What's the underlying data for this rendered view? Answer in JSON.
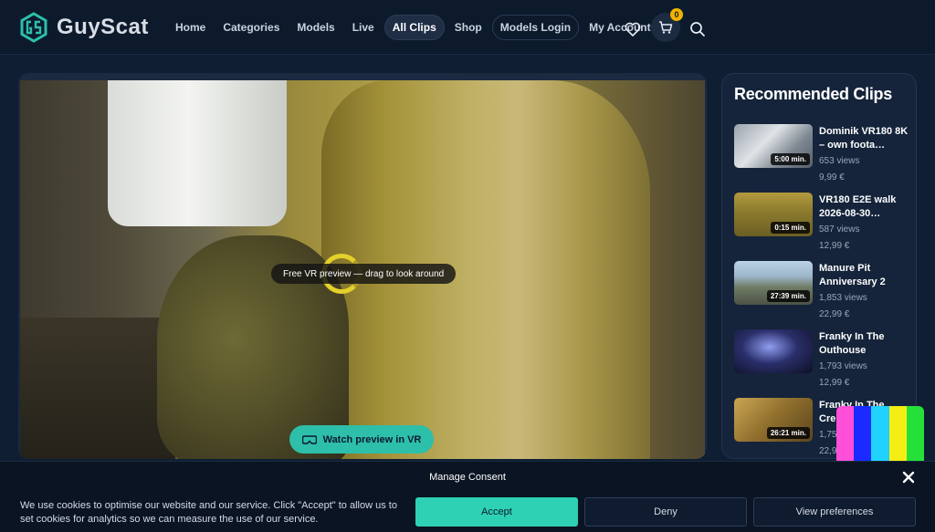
{
  "brand": {
    "name": "GuyScat",
    "logo_icon": "gs-hex-logo-icon",
    "accent": "#2dbfa9"
  },
  "nav": {
    "items": [
      {
        "label": "Home"
      },
      {
        "label": "Categories"
      },
      {
        "label": "Models"
      },
      {
        "label": "Live"
      },
      {
        "label": "All Clips",
        "active": true
      },
      {
        "label": "Shop"
      },
      {
        "label": "Models Login",
        "outlined": true
      },
      {
        "label": "My Account"
      }
    ],
    "icons": {
      "wishlist": "heart-icon",
      "cart": "cart-icon",
      "search": "search-icon"
    },
    "cart_count": "0"
  },
  "player": {
    "hint": "Free VR preview — drag to look around",
    "vr_button": "Watch preview in VR",
    "vr_icon": "vr-headset-icon"
  },
  "sidebar": {
    "title": "Recommended Clips",
    "clips": [
      {
        "title": "Dominik VR180 8K – own foota…",
        "duration": "5:00 min.",
        "views": "653 views",
        "price": "9,99 €"
      },
      {
        "title": "VR180 E2E walk 2026-08-30…",
        "duration": "0:15 min.",
        "views": "587 views",
        "price": "12,99 €"
      },
      {
        "title": "Manure Pit Anniversary 2",
        "duration": "27:39 min.",
        "views": "1,853 views",
        "price": "22,99 €"
      },
      {
        "title": "Franky In The Outhouse",
        "duration": "",
        "views": "1,793 views",
        "price": "12,99 €"
      },
      {
        "title": "Franky In The Cre…",
        "duration": "26:21 min.",
        "views": "1,75…",
        "price": "22,9…"
      }
    ]
  },
  "consent": {
    "title": "Manage Consent",
    "text": "We use cookies to optimise our website and our service. Click \"Accept\" to allow us to set cookies for analytics so we can measure the use of our service.",
    "accept": "Accept",
    "deny": "Deny",
    "preferences": "View preferences",
    "close_icon": "close-icon"
  }
}
